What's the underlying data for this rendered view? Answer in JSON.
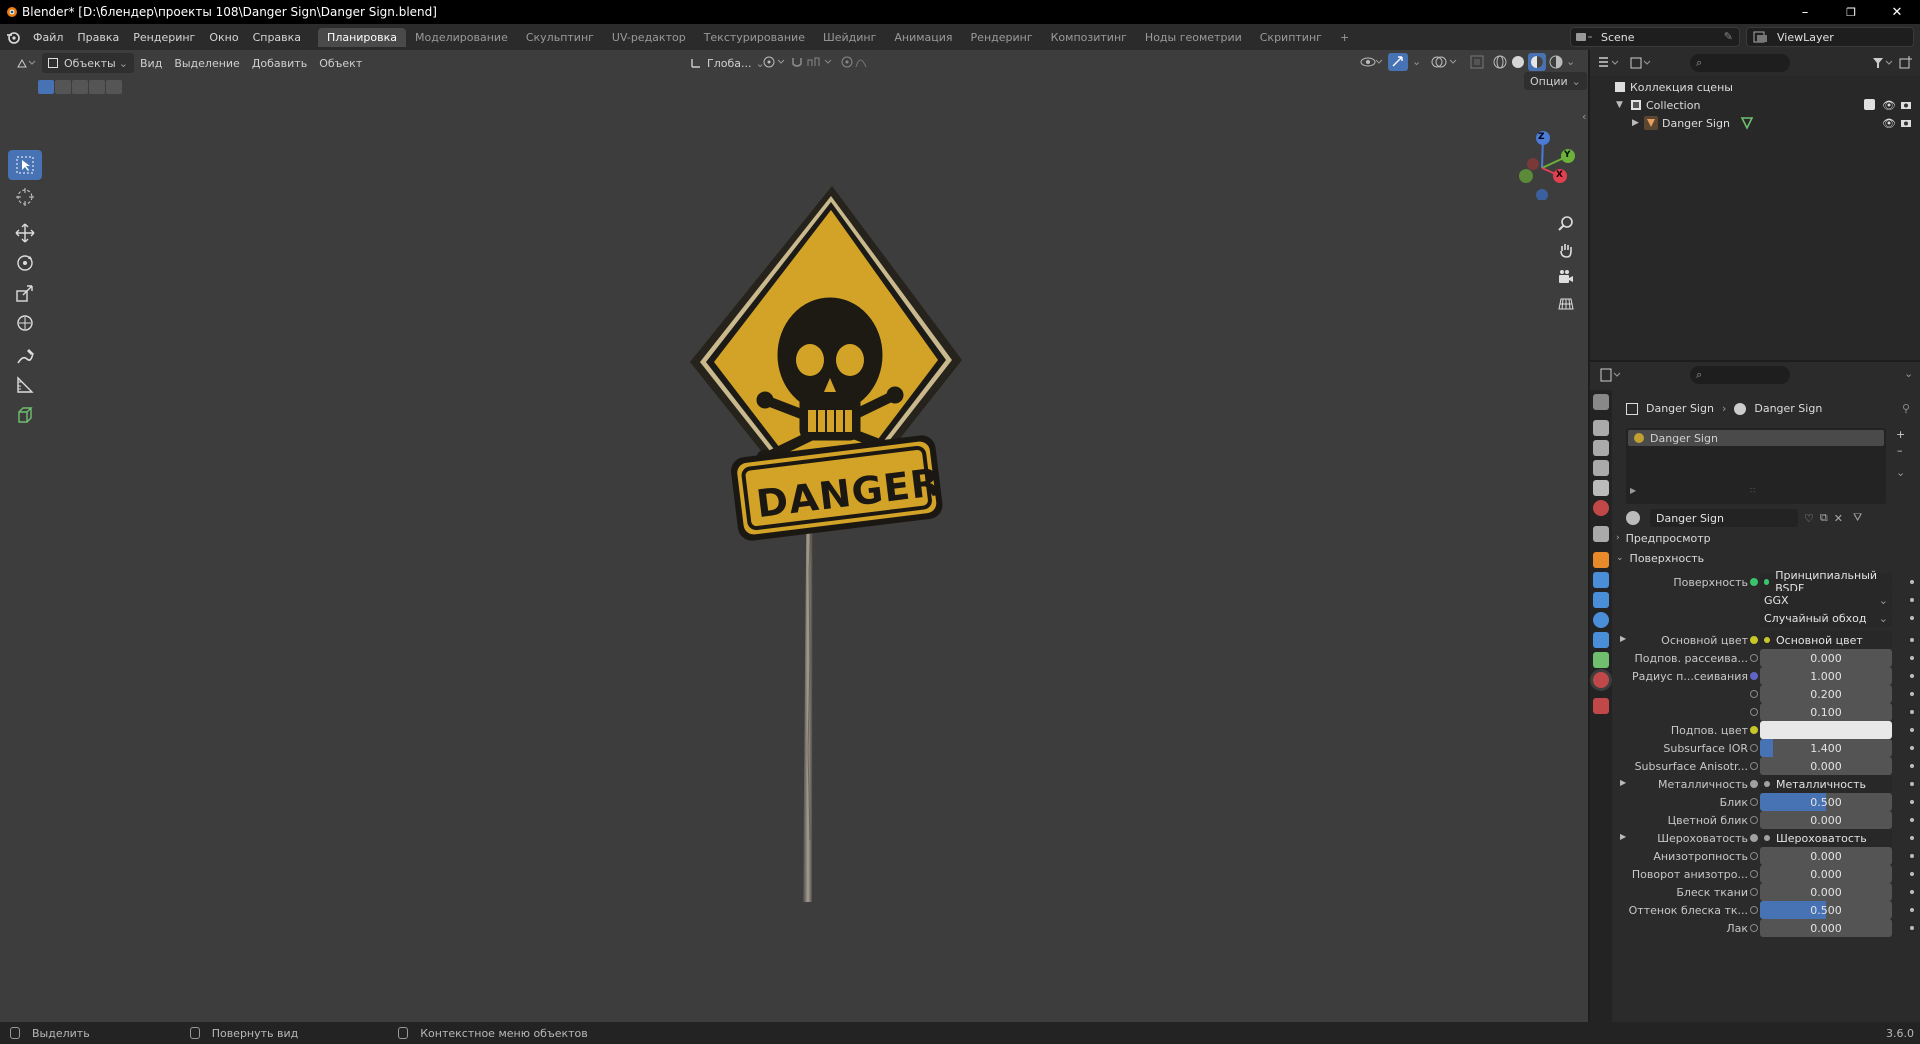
{
  "window": {
    "title": "Blender* [D:\\блендер\\проекты 108\\Danger Sign\\Danger Sign.blend]",
    "minimize": "–",
    "maximize": "❐",
    "close": "✕"
  },
  "menu": [
    "Файл",
    "Правка",
    "Рендеринг",
    "Окно",
    "Справка"
  ],
  "workspaces": [
    {
      "label": "Планировка",
      "active": true
    },
    {
      "label": "Моделирование"
    },
    {
      "label": "Скульптинг"
    },
    {
      "label": "UV-редактор"
    },
    {
      "label": "Текстурирование"
    },
    {
      "label": "Шейдинг"
    },
    {
      "label": "Анимация"
    },
    {
      "label": "Рендеринг"
    },
    {
      "label": "Композитинг"
    },
    {
      "label": "Ноды геометрии"
    },
    {
      "label": "Скриптинг"
    },
    {
      "label": "+"
    }
  ],
  "scene": {
    "scene_name": "Scene",
    "view_layer": "ViewLayer"
  },
  "viewport": {
    "mode": "Объекты",
    "menu": [
      "Вид",
      "Выделение",
      "Добавить",
      "Объект"
    ],
    "transform_orientation": "Глоба...",
    "options": "Опции",
    "gizmo_axes": {
      "z": "Z",
      "y": "Y",
      "x": "X"
    }
  },
  "sign": {
    "top_symbol": "skull-and-crossbones",
    "plate_text": "DANGER"
  },
  "outliner": {
    "scene_collection": "Коллекция сцены",
    "collection": "Collection",
    "object": "Danger Sign"
  },
  "properties": {
    "breadcrumb_object": "Danger Sign",
    "breadcrumb_material": "Danger Sign",
    "slot": "Danger Sign",
    "material_name": "Danger Sign",
    "preview_section": "Предпросмотр",
    "surface_section": "Поверхность",
    "rows": [
      {
        "label": "Поверхность",
        "kind": "link",
        "value": "Принципиальный BSDF",
        "dot": "#39c46a"
      },
      {
        "label": "",
        "kind": "select",
        "value": "GGX"
      },
      {
        "label": "",
        "kind": "select",
        "value": "Случайный обход"
      },
      {
        "label": "Основной цвет",
        "kind": "link",
        "value": "Основной цвет",
        "dot": "#c7c729",
        "expand": true
      },
      {
        "label": "Подпов. рассеива...",
        "kind": "num",
        "value": "0.000",
        "fill": 0
      },
      {
        "label": "Радиус п...сеивания",
        "kind": "num",
        "value": "1.000",
        "fill": 0,
        "dot": "#6363c7"
      },
      {
        "label": "",
        "kind": "num",
        "value": "0.200",
        "fill": 0
      },
      {
        "label": "",
        "kind": "num",
        "value": "0.100",
        "fill": 0
      },
      {
        "label": "Подпов. цвет",
        "kind": "color",
        "value": "#e8e8e8",
        "dot": "#c7c729"
      },
      {
        "label": "Subsurface IOR",
        "kind": "num",
        "value": "1.400",
        "fill": 0.1
      },
      {
        "label": "Subsurface Anisotr...",
        "kind": "num",
        "value": "0.000",
        "fill": 0
      },
      {
        "label": "Металличность",
        "kind": "link",
        "value": "Металличность",
        "dot": "#a1a1a1",
        "expand": true
      },
      {
        "label": "Блик",
        "kind": "num",
        "value": "0.500",
        "fill": 0.5
      },
      {
        "label": "Цветной блик",
        "kind": "num",
        "value": "0.000",
        "fill": 0
      },
      {
        "label": "Шероховатость",
        "kind": "link",
        "value": "Шероховатость",
        "dot": "#a1a1a1",
        "expand": true
      },
      {
        "label": "Анизотропность",
        "kind": "num",
        "value": "0.000",
        "fill": 0
      },
      {
        "label": "Поворот анизотро...",
        "kind": "num",
        "value": "0.000",
        "fill": 0
      },
      {
        "label": "Блеск ткани",
        "kind": "num",
        "value": "0.000",
        "fill": 0
      },
      {
        "label": "Оттенок блеска тк...",
        "kind": "num",
        "value": "0.500",
        "fill": 0.5
      },
      {
        "label": "Лак",
        "kind": "num",
        "value": "0.000",
        "fill": 0
      }
    ]
  },
  "status": {
    "select": "Выделить",
    "rotate": "Повернуть вид",
    "context": "Контекстное меню объектов",
    "version": "3.6.0"
  }
}
